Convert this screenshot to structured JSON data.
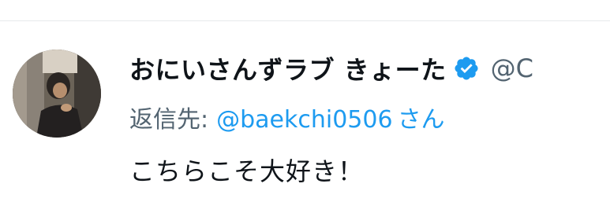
{
  "tweet": {
    "author": {
      "display_name": "おにいさんずラブ きょーた",
      "handle": "@C",
      "verified_icon": "verified-badge-icon",
      "avatar_icon": "user-avatar"
    },
    "reply": {
      "prefix": "返信先:",
      "to_handle": "@baekchi0506",
      "suffix": "さん"
    },
    "text": "こちらこそ大好き！"
  },
  "colors": {
    "primary_text": "#0f1419",
    "secondary_text": "#536471",
    "link": "#1d9bf0",
    "verified": "#1d9bf0",
    "divider": "#e6e9ec"
  }
}
